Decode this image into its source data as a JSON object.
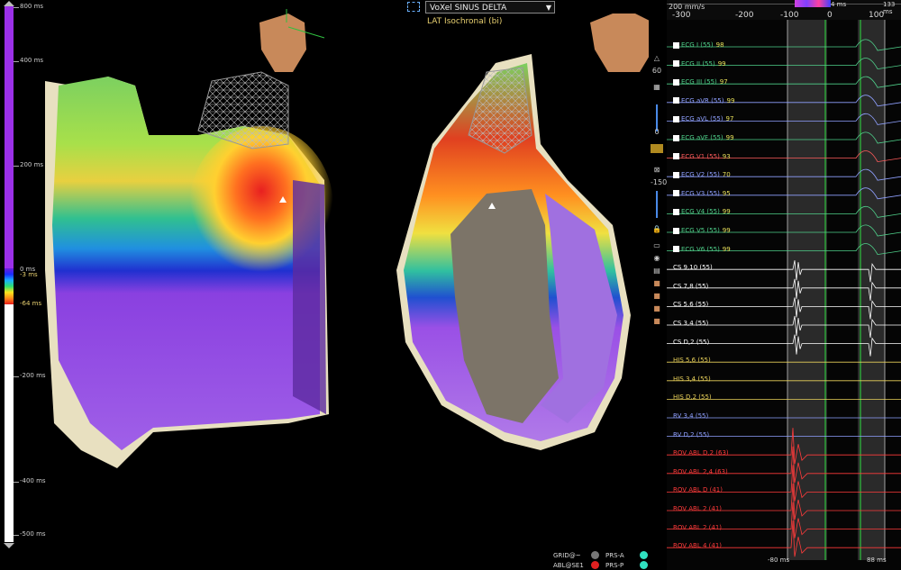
{
  "scale": {
    "ticks": [
      "800 ms",
      "400 ms",
      "200 ms",
      "0 ms",
      "-3 ms",
      "-64 ms",
      "-200 ms",
      "-400 ms",
      "-500 ms"
    ]
  },
  "header": {
    "map_name": "VoXel SINUS DELTA",
    "map_mode": "LAT Isochronal (bi)"
  },
  "toolbar": {
    "value_top": "60",
    "value_mid": "0",
    "value_bottom": "-150"
  },
  "ecg": {
    "speed": "200 mm/s",
    "axis": [
      "-300",
      "-200",
      "-100",
      "0",
      "100"
    ],
    "marker_left": "4 ms",
    "marker_right": "133 ms",
    "bottom_left": "-80 ms",
    "bottom_right": "88 ms",
    "channels": [
      {
        "name": "ECG I (55)",
        "val": "98",
        "color": "#4fd08a",
        "check": true
      },
      {
        "name": "ECG II (55)",
        "val": "99",
        "color": "#4fd08a",
        "check": true
      },
      {
        "name": "ECG III (55)",
        "val": "97",
        "color": "#4fd08a",
        "check": true
      },
      {
        "name": "ECG aVR (55)",
        "val": "99",
        "color": "#8fa0ff",
        "check": true
      },
      {
        "name": "ECG aVL (55)",
        "val": "97",
        "color": "#8fa0ff",
        "check": true
      },
      {
        "name": "ECG aVF (55)",
        "val": "99",
        "color": "#4fd08a",
        "check": true
      },
      {
        "name": "ECG V1 (55)",
        "val": "93",
        "color": "#ff5b5b",
        "check": true
      },
      {
        "name": "ECG V2 (55)",
        "val": "70",
        "color": "#8fa0ff",
        "check": true
      },
      {
        "name": "ECG V3 (55)",
        "val": "95",
        "color": "#8fa0ff",
        "check": true
      },
      {
        "name": "ECG V4 (55)",
        "val": "99",
        "color": "#4fd08a",
        "check": true
      },
      {
        "name": "ECG V5 (55)",
        "val": "99",
        "color": "#4fd08a",
        "check": true
      },
      {
        "name": "ECG V6 (55)",
        "val": "99",
        "color": "#4fd08a",
        "check": true
      },
      {
        "name": "CS 9,10 (55)",
        "val": "",
        "color": "#ffffff",
        "check": false
      },
      {
        "name": "CS 7,8 (55)",
        "val": "",
        "color": "#ffffff",
        "check": false
      },
      {
        "name": "CS 5,6 (55)",
        "val": "",
        "color": "#ffffff",
        "check": false
      },
      {
        "name": "CS 3,4 (55)",
        "val": "",
        "color": "#ffffff",
        "check": false
      },
      {
        "name": "CS D,2 (55)",
        "val": "",
        "color": "#ffffff",
        "check": false
      },
      {
        "name": "HIS 5,6 (55)",
        "val": "",
        "color": "#e8d05a",
        "check": false
      },
      {
        "name": "HIS 3,4 (55)",
        "val": "",
        "color": "#e8d05a",
        "check": false
      },
      {
        "name": "HIS D,2 (55)",
        "val": "",
        "color": "#e8d05a",
        "check": false
      },
      {
        "name": "RV 3,4 (55)",
        "val": "",
        "color": "#8fa0ff",
        "check": false
      },
      {
        "name": "RV D,2 (55)",
        "val": "",
        "color": "#8fa0ff",
        "check": false
      },
      {
        "name": "ROV ABL D,2 (63)",
        "val": "",
        "color": "#ff3b3b",
        "check": false
      },
      {
        "name": "ROV ABL 2,4 (63)",
        "val": "",
        "color": "#ff3b3b",
        "check": false
      },
      {
        "name": "ROV ABL D (41)",
        "val": "",
        "color": "#ff3b3b",
        "check": false
      },
      {
        "name": "ROV ABL 2 (41)",
        "val": "",
        "color": "#ff3b3b",
        "check": false
      },
      {
        "name": "ROV ABL 2 (41)",
        "val": "",
        "color": "#ff3b3b",
        "check": false
      },
      {
        "name": "ROV ABL 4 (41)",
        "val": "",
        "color": "#ff3b3b",
        "check": false
      }
    ]
  },
  "legend": {
    "grid": "GRID@~",
    "abl": "ABL@SE1",
    "prs_a": "PRS-A",
    "prs_p": "PRS-P"
  }
}
